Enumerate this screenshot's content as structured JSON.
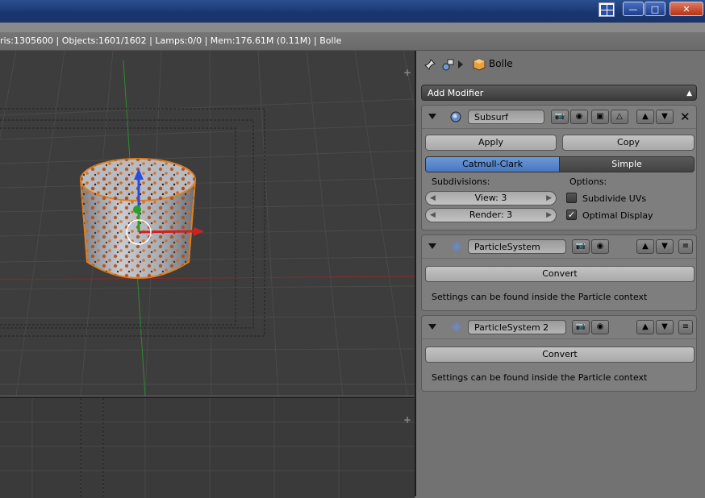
{
  "window": {
    "minimize_glyph": "—",
    "maximize_glyph": "□",
    "close_glyph": "✕"
  },
  "infobar": {
    "text": "ris:1305600 | Objects:1601/1602 | Lamps:0/0 | Mem:176.61M (0.11M) | Bolle"
  },
  "properties": {
    "breadcrumb": {
      "object_name": "Bolle",
      "icons": [
        "pin-icon",
        "scene-icon",
        "chevron-right-icon",
        "object-cube-icon"
      ]
    },
    "add_modifier_label": "Add Modifier",
    "modifiers": [
      {
        "name": "Subsurf",
        "apply_label": "Apply",
        "copy_label": "Copy",
        "mode_active": "Catmull-Clark",
        "mode_inactive": "Simple",
        "subdivisions_label": "Subdivisions:",
        "view_field": "View: 3",
        "render_field": "Render: 3",
        "options_label": "Options:",
        "opt_subdivide_uvs": "Subdivide UVs",
        "opt_subdivide_uvs_checked": false,
        "opt_optimal_display": "Optimal Display",
        "opt_optimal_display_checked": true
      },
      {
        "name": "ParticleSystem",
        "convert_label": "Convert",
        "info": "Settings can be found inside the Particle context"
      },
      {
        "name": "ParticleSystem 2",
        "convert_label": "Convert",
        "info": "Settings can be found inside the Particle context"
      }
    ]
  },
  "colors": {
    "viewport_bg": "#3d3d3d",
    "x_axis": "#c03030",
    "y_axis": "#30a030",
    "active_segment": "#5a88d0",
    "selection_outline": "#e08020"
  }
}
